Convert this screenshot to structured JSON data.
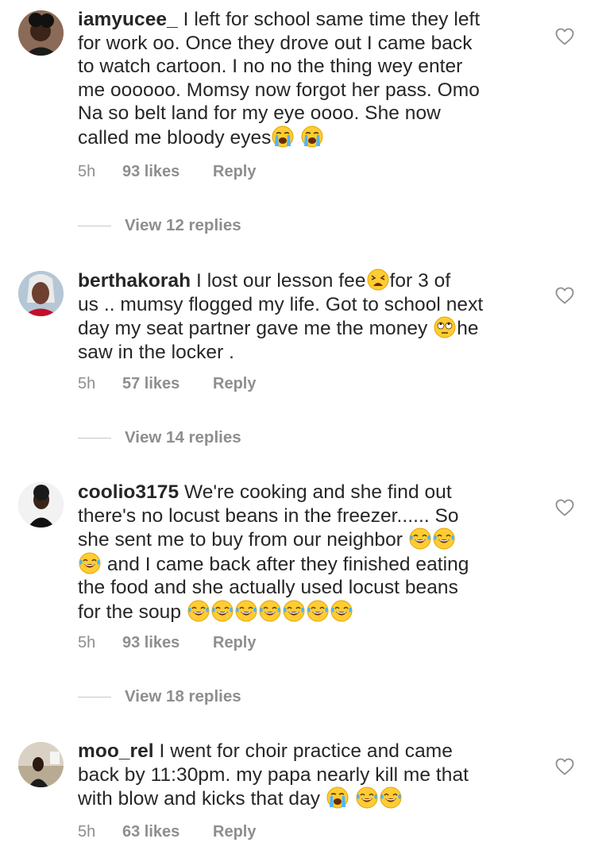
{
  "comments": [
    {
      "username": "iamyucee_",
      "lines": [
        " I left for school same time they left",
        "for work oo. Once they drove out I came back",
        "to watch cartoon. I no no the thing wey enter",
        "me oooooo. Momsy now forgot her pass. Omo",
        "Na so belt land for my eye oooo. She now",
        "called me bloody eyes"
      ],
      "time": "5h",
      "likes": "93 likes",
      "reply": "Reply",
      "view_replies": "View 12 replies"
    },
    {
      "username": "berthakorah",
      "lines": [
        " I lost our lesson fee",
        "for 3 of",
        "us .. mumsy flogged my life. Got to school next",
        "day my seat partner gave me the money ",
        "he",
        "saw in the locker ."
      ],
      "time": "5h",
      "likes": "57 likes",
      "reply": "Reply",
      "view_replies": "View 14 replies"
    },
    {
      "username": "coolio3175",
      "lines": [
        " We're cooking and she find out",
        "there's no locust beans in the freezer...... So",
        "she sent me to buy from our neighbor ",
        " and I came back after they finished eating",
        "the food and she actually used locust beans",
        "for the soup "
      ],
      "time": "5h",
      "likes": "93 likes",
      "reply": "Reply",
      "view_replies": "View 18 replies"
    },
    {
      "username": "moo_rel",
      "lines": [
        " I went for choir practice and came",
        "back by 11:30pm. my papa nearly kill me that",
        "with blow and kicks that day "
      ],
      "time": "5h",
      "likes": "63 likes",
      "reply": "Reply"
    }
  ],
  "icons": {
    "heart": "heart-outline-icon",
    "crying": "loudly-crying-face-emoji",
    "laughing": "tears-of-joy-emoji",
    "weary": "weary-face-emoji",
    "eye_roll": "rolling-eyes-emoji"
  },
  "colors": {
    "text": "#262626",
    "secondary": "#8e8e8e",
    "emoji_yellow": "#ffcc33"
  }
}
